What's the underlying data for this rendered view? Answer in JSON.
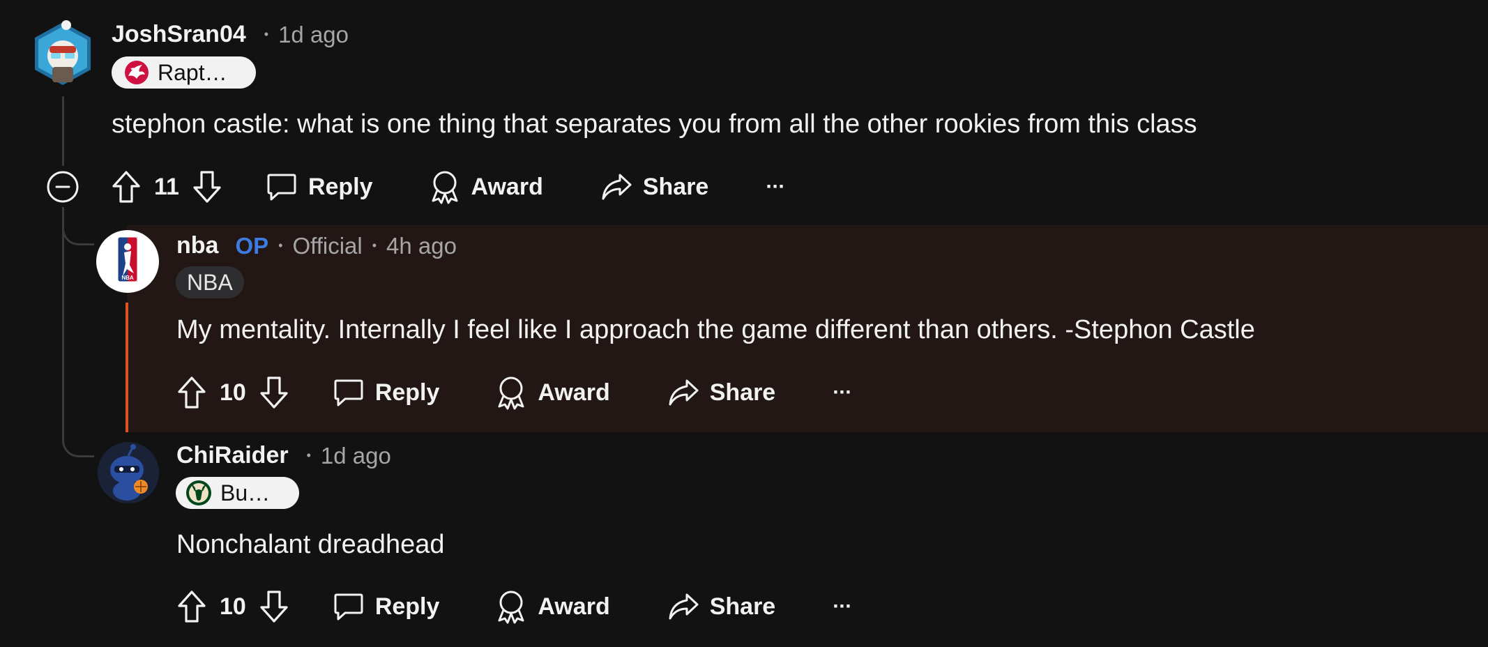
{
  "comments": [
    {
      "username": "JoshSran04",
      "time": "1d ago",
      "flair": "Rapt…",
      "flair_icon": "raptors-logo-icon",
      "body": "stephon castle: what is one thing that separates you from all the other rookies from this class",
      "votes": "11"
    },
    {
      "username": "nba",
      "op_label": "OP",
      "official_label": "Official",
      "time": "4h ago",
      "flair": "NBA",
      "body": "My mentality. Internally I feel like I approach the game different than others. -Stephon Castle",
      "votes": "10"
    },
    {
      "username": "ChiRaider",
      "time": "1d ago",
      "flair": "Bu…",
      "flair_icon": "bucks-logo-icon",
      "body": "Nonchalant dreadhead",
      "votes": "10"
    }
  ],
  "actions": {
    "reply": "Reply",
    "award": "Award",
    "share": "Share",
    "more": "···"
  },
  "separator": "•",
  "colors": {
    "background": "#121213",
    "op_blue": "#3d7be0",
    "op_highlight": "#221715",
    "op_bar": "#d9541e"
  }
}
